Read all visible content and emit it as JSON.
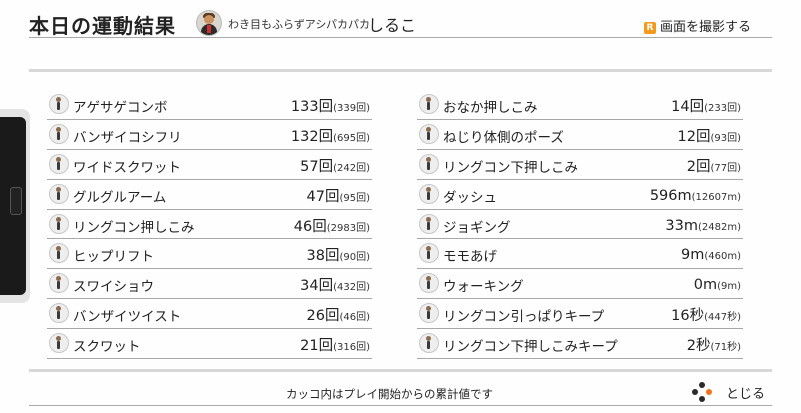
{
  "header": {
    "title": "本日の運動結果",
    "user_subtitle": "わき目もふらずアシパカパカ",
    "user_name": "しるこ",
    "capture_badge": "R",
    "capture_label": "画面を撮影する"
  },
  "left_column": [
    {
      "name": "アゲサゲコンボ",
      "value": "133回",
      "total": "(339回)"
    },
    {
      "name": "バンザイコシフリ",
      "value": "132回",
      "total": "(695回)"
    },
    {
      "name": "ワイドスクワット",
      "value": "57回",
      "total": "(242回)"
    },
    {
      "name": "グルグルアーム",
      "value": "47回",
      "total": "(95回)"
    },
    {
      "name": "リングコン押しこみ",
      "value": "46回",
      "total": "(2983回)"
    },
    {
      "name": "ヒップリフト",
      "value": "38回",
      "total": "(90回)"
    },
    {
      "name": "スワイショウ",
      "value": "34回",
      "total": "(432回)"
    },
    {
      "name": "バンザイツイスト",
      "value": "26回",
      "total": "(46回)"
    },
    {
      "name": "スクワット",
      "value": "21回",
      "total": "(316回)"
    }
  ],
  "right_column": [
    {
      "name": "おなか押しこみ",
      "value": "14回",
      "total": "(233回)"
    },
    {
      "name": "ねじり体側のポーズ",
      "value": "12回",
      "total": "(93回)"
    },
    {
      "name": "リングコン下押しこみ",
      "value": "2回",
      "total": "(77回)"
    },
    {
      "name": "ダッシュ",
      "value": "596m",
      "total": "(12607m)"
    },
    {
      "name": "ジョギング",
      "value": "33m",
      "total": "(2482m)"
    },
    {
      "name": "モモあげ",
      "value": "9m",
      "total": "(460m)"
    },
    {
      "name": "ウォーキング",
      "value": "0m",
      "total": "(9m)"
    },
    {
      "name": "リングコン引っぱりキープ",
      "value": "16秒",
      "total": "(447秒)"
    },
    {
      "name": "リングコン下押しこみキープ",
      "value": "2秒",
      "total": "(71秒)"
    }
  ],
  "footer": {
    "note": "カッコ内はプレイ開始からの累計値です",
    "close_label": "とじる"
  },
  "colors": {
    "accent": "#f39a1e",
    "close_dot": "#f0731e"
  },
  "icons": {
    "exercise": "exercise-pose-icon",
    "capture": "r-button-icon",
    "close": "controller-buttons-icon"
  }
}
